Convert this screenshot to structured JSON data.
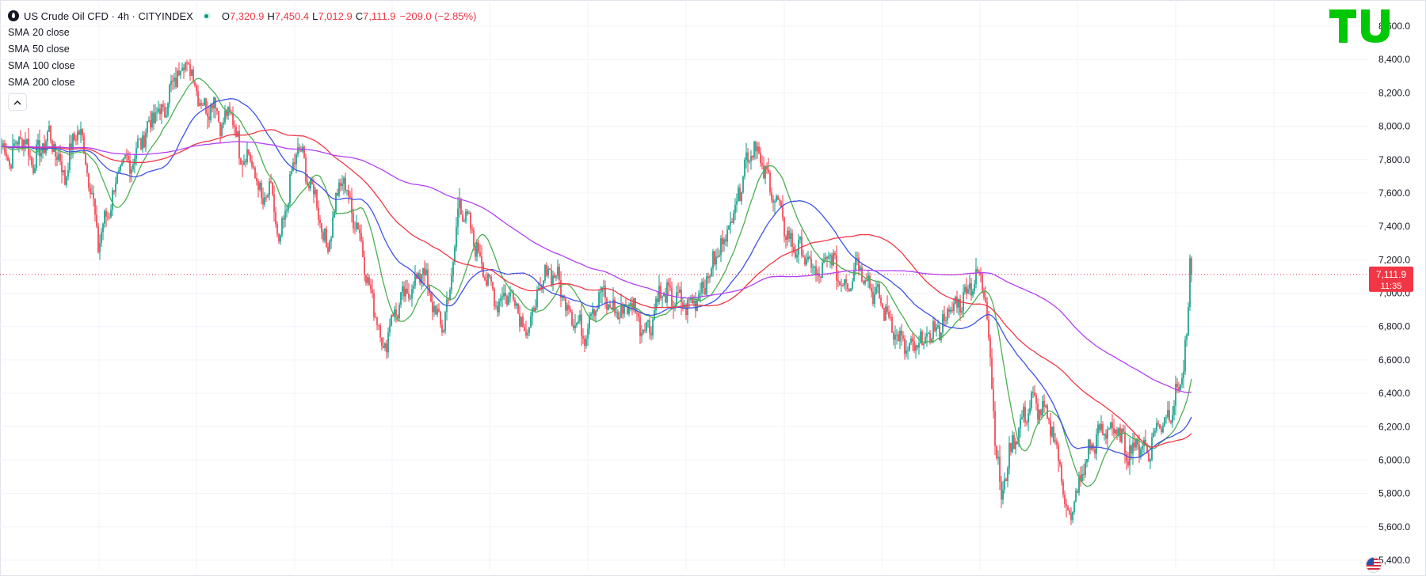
{
  "header": {
    "symbol_title": "US Crude Oil CFD · 4h · CITYINDEX",
    "open_label": "O",
    "open_value": "7,320.9",
    "high_label": "H",
    "high_value": "7,450.4",
    "low_label": "L",
    "low_value": "7,012.9",
    "close_label": "C",
    "close_value": "7,111.9",
    "change_value": "−209.0 (−2.85%)",
    "symbol_icon": "oil-drop-icon",
    "market_status_icon": "market-open-dot-icon"
  },
  "indicators": [
    {
      "name": "SMA",
      "param": "20 close",
      "color": "#4caf50"
    },
    {
      "name": "SMA",
      "param": "50 close",
      "color": "#3f51e8"
    },
    {
      "name": "SMA",
      "param": "100 close",
      "color": "#f23645"
    },
    {
      "name": "SMA",
      "param": "200 close",
      "color": "#b33ff5"
    }
  ],
  "collapse_icon": "chevron-up-icon",
  "price_axis": {
    "ticks": [
      "8,600.0",
      "8,400.0",
      "8,200.0",
      "8,000.0",
      "7,800.0",
      "7,600.0",
      "7,400.0",
      "7,200.0",
      "7,000.0",
      "6,800.0",
      "6,600.0",
      "6,400.0",
      "6,200.0",
      "6,000.0",
      "5,800.0",
      "5,600.0",
      "5,400.0"
    ],
    "last_price_label": "7,111.9",
    "countdown_label": "11:35",
    "last_price_color": "#f23645"
  },
  "colors": {
    "up": "#089981",
    "down": "#f23645",
    "grid": "#f0f3fa",
    "logo": "#00c805"
  },
  "logo_icon": "tradingview-logo-icon",
  "flag_icon": "us-flag-icon",
  "chart_data": {
    "type": "candlestick",
    "title": "US Crude Oil CFD · 4h · CITYINDEX",
    "ylim": [
      5400,
      8600
    ],
    "grid": true,
    "last_price": 7111.9,
    "series": [
      {
        "name": "SMA 20 close",
        "color": "#4caf50"
      },
      {
        "name": "SMA 50 close",
        "color": "#3f51e8"
      },
      {
        "name": "SMA 100 close",
        "color": "#f23645"
      },
      {
        "name": "SMA 200 close",
        "color": "#b33ff5"
      }
    ],
    "path_close": [
      [
        0,
        7880
      ],
      [
        10,
        7800
      ],
      [
        25,
        7950
      ],
      [
        40,
        7780
      ],
      [
        60,
        7950
      ],
      [
        80,
        7700
      ],
      [
        95,
        8000
      ],
      [
        105,
        7850
      ],
      [
        115,
        7550
      ],
      [
        122,
        7300
      ],
      [
        135,
        7500
      ],
      [
        150,
        7750
      ],
      [
        165,
        7800
      ],
      [
        175,
        7900
      ],
      [
        190,
        8050
      ],
      [
        205,
        8100
      ],
      [
        220,
        8300
      ],
      [
        232,
        8400
      ],
      [
        245,
        8250
      ],
      [
        255,
        8100
      ],
      [
        268,
        8150
      ],
      [
        278,
        8000
      ],
      [
        290,
        8100
      ],
      [
        300,
        7850
      ],
      [
        315,
        7800
      ],
      [
        328,
        7550
      ],
      [
        342,
        7600
      ],
      [
        350,
        7250
      ],
      [
        362,
        7600
      ],
      [
        375,
        7900
      ],
      [
        385,
        7700
      ],
      [
        398,
        7550
      ],
      [
        410,
        7250
      ],
      [
        420,
        7500
      ],
      [
        430,
        7700
      ],
      [
        445,
        7450
      ],
      [
        455,
        7300
      ],
      [
        462,
        7050
      ],
      [
        472,
        6900
      ],
      [
        482,
        6650
      ],
      [
        492,
        6850
      ],
      [
        505,
        6950
      ],
      [
        520,
        7050
      ],
      [
        532,
        7150
      ],
      [
        545,
        6900
      ],
      [
        558,
        6800
      ],
      [
        568,
        7100
      ],
      [
        578,
        7550
      ],
      [
        590,
        7400
      ],
      [
        605,
        7200
      ],
      [
        615,
        7050
      ],
      [
        625,
        6950
      ],
      [
        640,
        7000
      ],
      [
        650,
        6950
      ],
      [
        662,
        6750
      ],
      [
        675,
        6950
      ],
      [
        690,
        7150
      ],
      [
        700,
        7100
      ],
      [
        712,
        6950
      ],
      [
        722,
        6850
      ],
      [
        735,
        6750
      ],
      [
        745,
        6900
      ],
      [
        758,
        7000
      ],
      [
        770,
        6900
      ],
      [
        782,
        6880
      ],
      [
        795,
        6950
      ],
      [
        808,
        6800
      ],
      [
        818,
        6800
      ],
      [
        830,
        7000
      ],
      [
        842,
        6980
      ],
      [
        855,
        6950
      ],
      [
        868,
        6920
      ],
      [
        880,
        7000
      ],
      [
        892,
        7100
      ],
      [
        905,
        7250
      ],
      [
        918,
        7400
      ],
      [
        930,
        7600
      ],
      [
        940,
        7800
      ],
      [
        950,
        7900
      ],
      [
        960,
        7750
      ],
      [
        970,
        7650
      ],
      [
        985,
        7450
      ],
      [
        995,
        7300
      ],
      [
        1010,
        7250
      ],
      [
        1022,
        7150
      ],
      [
        1035,
        7100
      ],
      [
        1045,
        7250
      ],
      [
        1055,
        7100
      ],
      [
        1068,
        7050
      ],
      [
        1080,
        7200
      ],
      [
        1090,
        7100
      ],
      [
        1102,
        7000
      ],
      [
        1115,
        6900
      ],
      [
        1125,
        6800
      ],
      [
        1135,
        6700
      ],
      [
        1148,
        6650
      ],
      [
        1160,
        6700
      ],
      [
        1172,
        6750
      ],
      [
        1185,
        6800
      ],
      [
        1198,
        6900
      ],
      [
        1210,
        6950
      ],
      [
        1222,
        7050
      ],
      [
        1235,
        7100
      ],
      [
        1242,
        7000
      ],
      [
        1248,
        6600
      ],
      [
        1255,
        6100
      ],
      [
        1262,
        5750
      ],
      [
        1270,
        6000
      ],
      [
        1280,
        6150
      ],
      [
        1290,
        6250
      ],
      [
        1300,
        6350
      ],
      [
        1312,
        6300
      ],
      [
        1325,
        6200
      ],
      [
        1335,
        6000
      ],
      [
        1342,
        5750
      ],
      [
        1350,
        5650
      ],
      [
        1360,
        5850
      ],
      [
        1372,
        6050
      ],
      [
        1385,
        6150
      ],
      [
        1398,
        6200
      ],
      [
        1410,
        6150
      ],
      [
        1422,
        6050
      ],
      [
        1435,
        6100
      ],
      [
        1448,
        6050
      ],
      [
        1458,
        6200
      ],
      [
        1470,
        6250
      ],
      [
        1480,
        6350
      ],
      [
        1490,
        6500
      ],
      [
        1496,
        6750
      ],
      [
        1499,
        7000
      ],
      [
        1501,
        7420
      ],
      [
        1503,
        7112
      ]
    ]
  }
}
